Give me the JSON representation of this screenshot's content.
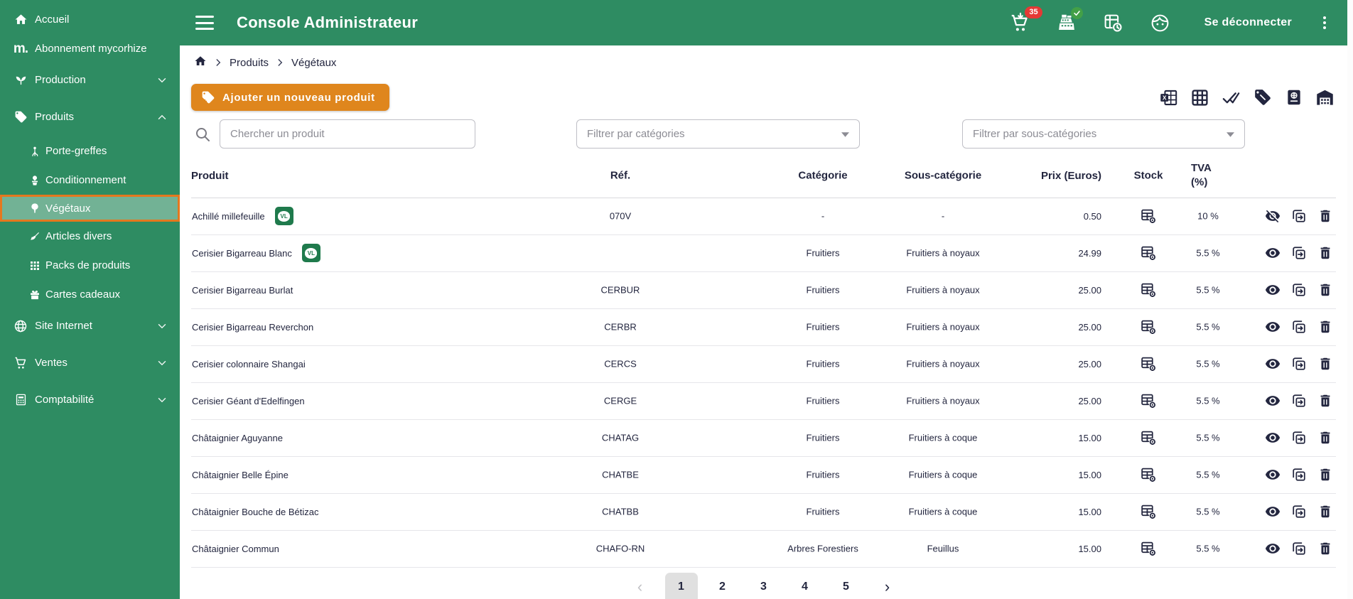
{
  "colors": {
    "green": "#2E8C62",
    "orange_button": "#DF861D",
    "selected_border": "#E5781E",
    "badge_red": "#E53935",
    "badge_green": "#43A047",
    "text_dark": "#23263F",
    "text_grey": "#8C8C94",
    "input_border": "#BFBFC6",
    "row_border": "#E6E6EA",
    "pagination_active_bg": "#E0E0E0",
    "vl_badge_green": "#1F7A4C"
  },
  "header": {
    "title": "Console Administrateur",
    "cart_badge": "35",
    "logout_label": "Se déconnecter",
    "icons": [
      "menu-icon",
      "cart-download-icon",
      "cash-register-icon",
      "table-clock-icon",
      "face-icon",
      "kebab-menu-icon"
    ]
  },
  "sidebar": {
    "items": [
      {
        "label": "Accueil",
        "icon": "home-icon"
      },
      {
        "label": "Abonnement mycorhize",
        "icon": "mycorhize-logo-icon"
      },
      {
        "label": "Production",
        "icon": "sprout-icon",
        "chevron": "down"
      },
      {
        "label": "Produits",
        "icon": "tag-icon",
        "chevron": "up",
        "expanded": true
      },
      {
        "label": "Porte-greffes",
        "icon": "rootstock-icon",
        "child": true
      },
      {
        "label": "Conditionnement",
        "icon": "potted-plant-icon",
        "child": true
      },
      {
        "label": "Végétaux",
        "icon": "tree-icon",
        "child": true,
        "selected": true
      },
      {
        "label": "Articles divers",
        "icon": "broom-icon",
        "child": true
      },
      {
        "label": "Packs de produits",
        "icon": "grid-icon",
        "child": true
      },
      {
        "label": "Cartes cadeaux",
        "icon": "gift-icon",
        "child": true
      },
      {
        "label": "Site Internet",
        "icon": "globe-icon",
        "chevron": "down"
      },
      {
        "label": "Ventes",
        "icon": "cart-icon",
        "chevron": "down"
      },
      {
        "label": "Comptabilité",
        "icon": "calculator-icon",
        "chevron": "down"
      }
    ]
  },
  "breadcrumb": {
    "home_icon": "home-icon",
    "items": [
      "Produits",
      "Végétaux"
    ]
  },
  "actions": {
    "add_button_label": "Ajouter un nouveau produit",
    "add_button_icon": "tag-plus-icon",
    "toolbar_icons": [
      "excel-export-icon",
      "table-grid-icon",
      "double-check-icon",
      "tag-icon",
      "passport-icon",
      "warehouse-icon"
    ]
  },
  "filters": {
    "search_placeholder": "Chercher un produit",
    "category_placeholder": "Filtrer par catégories",
    "subcategory_placeholder": "Filtrer par sous-catégories"
  },
  "table": {
    "columns": [
      "Produit",
      "Réf.",
      "Catégorie",
      "Sous-catégorie",
      "Prix (Euros)",
      "Stock",
      "TVA (%)"
    ],
    "tva_header_line1": "TVA",
    "tva_header_line2": "(%)",
    "vl_badge_text": "VL",
    "row_icons": [
      "stock-settings-icon",
      "visibility-icon",
      "duplicate-icon",
      "delete-icon"
    ],
    "rows": [
      {
        "name": "Achillé millefeuille",
        "vl_badge": true,
        "ref": "070V",
        "category": "-",
        "subcategory": "-",
        "price": "0.50",
        "tva": "10 %",
        "visible": false
      },
      {
        "name": "Cerisier Bigarreau Blanc",
        "vl_badge": true,
        "ref": "",
        "category": "Fruitiers",
        "subcategory": "Fruitiers à noyaux",
        "price": "24.99",
        "tva": "5.5 %",
        "visible": true
      },
      {
        "name": "Cerisier Bigarreau Burlat",
        "vl_badge": false,
        "ref": "CERBUR",
        "category": "Fruitiers",
        "subcategory": "Fruitiers à noyaux",
        "price": "25.00",
        "tva": "5.5 %",
        "visible": true
      },
      {
        "name": "Cerisier Bigarreau Reverchon",
        "vl_badge": false,
        "ref": "CERBR",
        "category": "Fruitiers",
        "subcategory": "Fruitiers à noyaux",
        "price": "25.00",
        "tva": "5.5 %",
        "visible": true
      },
      {
        "name": "Cerisier colonnaire Shangai",
        "vl_badge": false,
        "ref": "CERCS",
        "category": "Fruitiers",
        "subcategory": "Fruitiers à noyaux",
        "price": "25.00",
        "tva": "5.5 %",
        "visible": true
      },
      {
        "name": "Cerisier Géant d'Edelfingen",
        "vl_badge": false,
        "ref": "CERGE",
        "category": "Fruitiers",
        "subcategory": "Fruitiers à noyaux",
        "price": "25.00",
        "tva": "5.5 %",
        "visible": true
      },
      {
        "name": "Châtaignier Aguyanne",
        "vl_badge": false,
        "ref": "CHATAG",
        "category": "Fruitiers",
        "subcategory": "Fruitiers à coque",
        "price": "15.00",
        "tva": "5.5 %",
        "visible": true
      },
      {
        "name": "Châtaignier Belle Épine",
        "vl_badge": false,
        "ref": "CHATBE",
        "category": "Fruitiers",
        "subcategory": "Fruitiers à coque",
        "price": "15.00",
        "tva": "5.5 %",
        "visible": true
      },
      {
        "name": "Châtaignier Bouche de Bétizac",
        "vl_badge": false,
        "ref": "CHATBB",
        "category": "Fruitiers",
        "subcategory": "Fruitiers à coque",
        "price": "15.00",
        "tva": "5.5 %",
        "visible": true
      },
      {
        "name": "Châtaignier Commun",
        "vl_badge": false,
        "ref": "CHAFO-RN",
        "category": "Arbres Forestiers",
        "subcategory": "Feuillus",
        "price": "15.00",
        "tva": "5.5 %",
        "visible": true
      }
    ]
  },
  "pagination": {
    "prev": "‹",
    "next": "›",
    "pages": [
      "1",
      "2",
      "3",
      "4",
      "5"
    ],
    "active": "1"
  }
}
